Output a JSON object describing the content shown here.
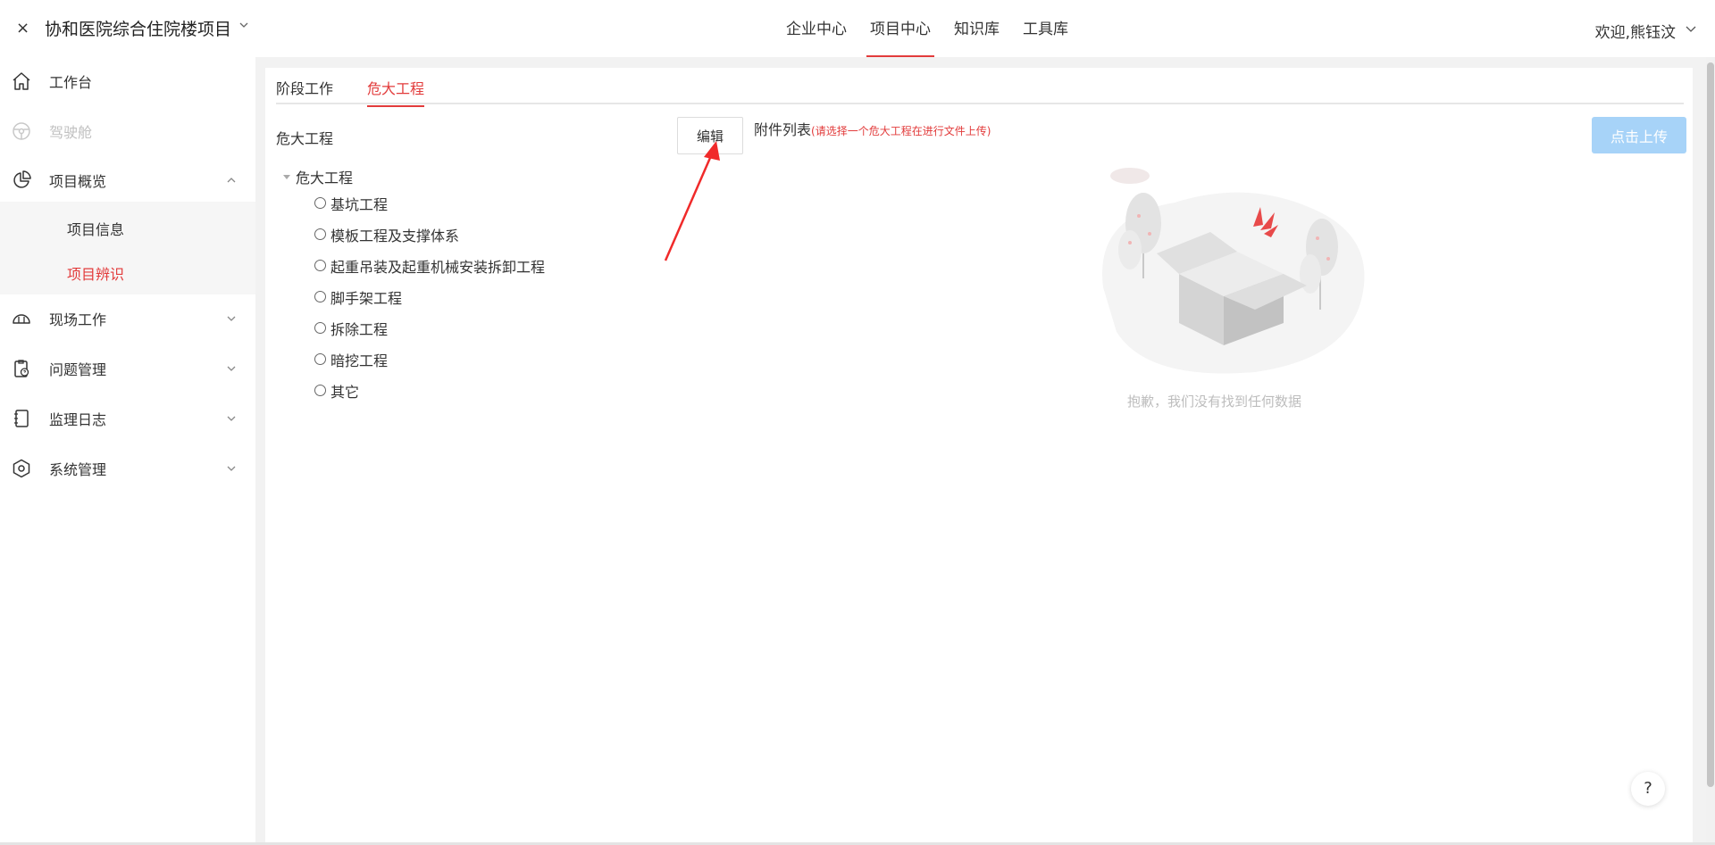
{
  "header": {
    "close_glyph": "×",
    "project_title": "协和医院综合住院楼项目",
    "nav": [
      {
        "label": "企业中心",
        "active": false
      },
      {
        "label": "项目中心",
        "active": true
      },
      {
        "label": "知识库",
        "active": false
      },
      {
        "label": "工具库",
        "active": false
      }
    ],
    "welcome": "欢迎,熊钰汶"
  },
  "sidebar": {
    "items": [
      {
        "label": "工作台",
        "icon": "home-icon"
      },
      {
        "label": "驾驶舱",
        "icon": "steering-wheel-icon",
        "disabled": true
      },
      {
        "label": "项目概览",
        "icon": "pie-chart-icon",
        "expanded": true
      },
      {
        "label": "现场工作",
        "icon": "helmet-icon"
      },
      {
        "label": "问题管理",
        "icon": "clipboard-question-icon"
      },
      {
        "label": "监理日志",
        "icon": "notebook-icon"
      },
      {
        "label": "系统管理",
        "icon": "hexagon-settings-icon"
      }
    ],
    "sub_items": [
      {
        "label": "项目信息",
        "active": false
      },
      {
        "label": "项目辨识",
        "active": true
      }
    ]
  },
  "main": {
    "tabs": [
      {
        "label": "阶段工作",
        "active": false
      },
      {
        "label": "危大工程",
        "active": true
      }
    ],
    "left_title": "危大工程",
    "edit_label": "编辑",
    "tree": {
      "root": "危大工程",
      "nodes": [
        "基坑工程",
        "模板工程及支撑体系",
        "起重吊装及起重机械安装拆卸工程",
        "脚手架工程",
        "拆除工程",
        "暗挖工程",
        "其它"
      ]
    },
    "attach_title": "附件列表",
    "attach_hint": "(请选择一个危大工程在进行文件上传)",
    "upload_label": "点击上传",
    "empty_text": "抱歉，我们没有找到任何数据"
  },
  "help_label": "?",
  "colors": {
    "accent": "#e23b3b",
    "upload_disabled": "#a7d3f8"
  }
}
